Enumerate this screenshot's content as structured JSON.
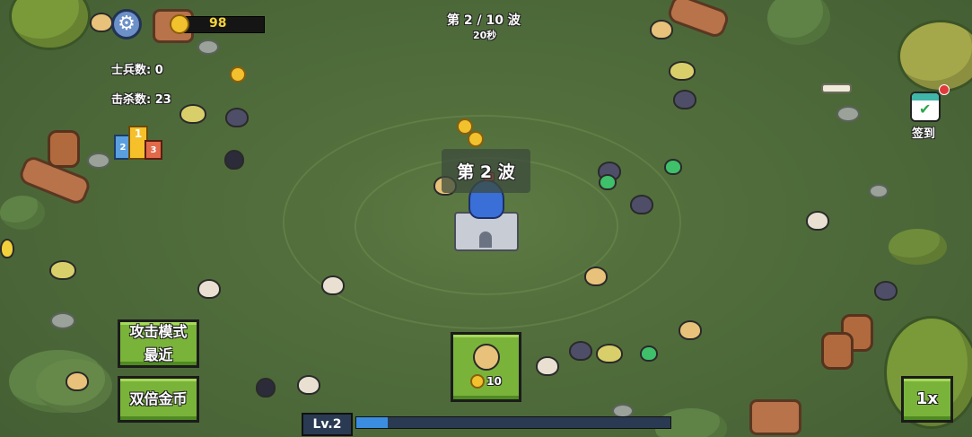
{
  "hud": {
    "gold": "98",
    "soldiers_label": "士兵数: 0",
    "kills_label": "击杀数: 23",
    "wave_counter": "第 2 / 10 波",
    "wave_timer": "20秒",
    "wave_banner": "第 2 波",
    "checkin_label": "签到"
  },
  "buttons": {
    "attack_mode_title": "攻击模式",
    "attack_mode_value": "最近",
    "double_gold": "双倍金币",
    "speed": "1x"
  },
  "recruit": {
    "cost": "10"
  },
  "level": {
    "label": "Lv.2",
    "progress": 0.1
  },
  "leaderboard": {
    "ranks": [
      "2",
      "1",
      "3"
    ]
  },
  "colors": {
    "button_green": "#7ab33a",
    "gold": "#f2c12e",
    "progress_fill": "#3b8de0",
    "castle_roof": "#3a6fd8"
  }
}
